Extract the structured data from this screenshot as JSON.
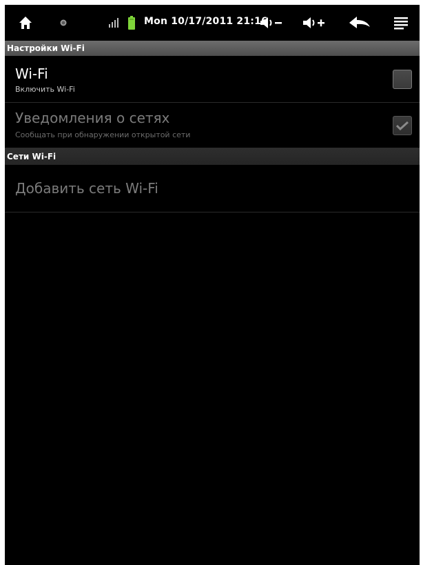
{
  "status_bar": {
    "datetime": "Mon 10/17/2011 21:16",
    "icons": [
      "home-icon",
      "notification-dot-icon",
      "signal-icon",
      "battery-icon",
      "volume-down-icon",
      "volume-up-icon",
      "back-icon",
      "menu-icon"
    ]
  },
  "sections": {
    "wifi_settings": "Настройки Wi-Fi",
    "wifi_networks": "Сети Wi-Fi"
  },
  "prefs": {
    "wifi": {
      "title": "Wi-Fi",
      "summary": "Включить Wi-Fi",
      "checked": false
    },
    "network_notify": {
      "title": "Уведомления о сетях",
      "summary": "Сообщать при обнаружении открытой сети",
      "checked": true,
      "enabled": false
    },
    "add_network": {
      "title": "Добавить сеть Wi-Fi",
      "enabled": false
    }
  },
  "colors": {
    "background": "#000000",
    "section_header": "#5e5e5e",
    "battery": "#7fd43a",
    "disabled_text": "#7b7b7b"
  }
}
